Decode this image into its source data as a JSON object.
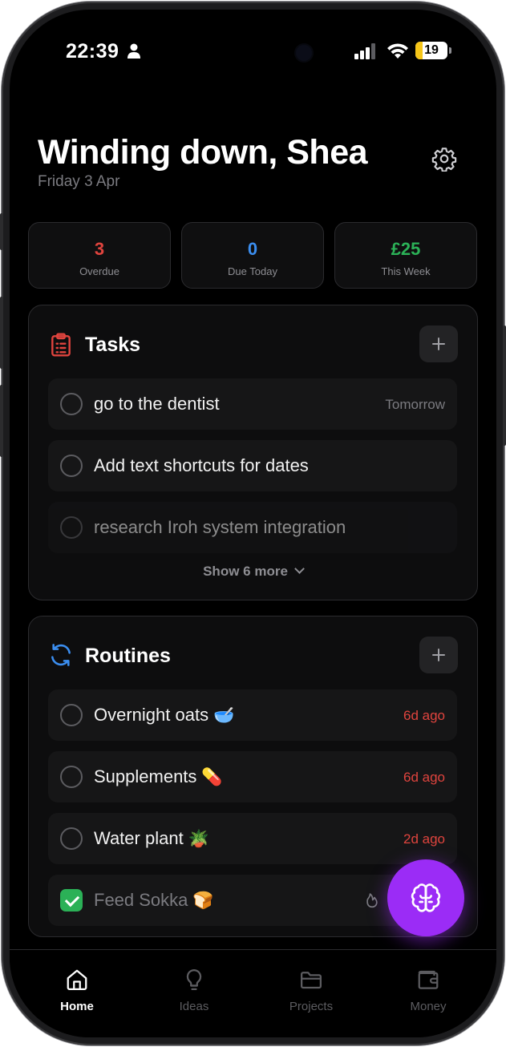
{
  "status_bar": {
    "time": "22:39",
    "battery": "19"
  },
  "header": {
    "greeting": "Winding down, Shea",
    "date": "Friday 3 Apr"
  },
  "stats": [
    {
      "value": "3",
      "label": "Overdue",
      "color": "#e0443e"
    },
    {
      "value": "0",
      "label": "Due Today",
      "color": "#3b8ef0"
    },
    {
      "value": "£25",
      "label": "This Week",
      "color": "#2bb157"
    }
  ],
  "tasks": {
    "title": "Tasks",
    "items": [
      {
        "label": "go to the dentist",
        "meta": "Tomorrow"
      },
      {
        "label": "Add text shortcuts for dates",
        "meta": ""
      },
      {
        "label": "research Iroh system integration",
        "meta": ""
      }
    ],
    "show_more": "Show 6 more"
  },
  "routines": {
    "title": "Routines",
    "items": [
      {
        "label": "Overnight oats",
        "emoji": "🥣",
        "meta": "6d ago"
      },
      {
        "label": "Supplements",
        "emoji": "💊",
        "meta": "6d ago"
      },
      {
        "label": "Water plant",
        "emoji": "🪴",
        "meta": "2d ago"
      },
      {
        "label": "Feed Sokka",
        "emoji": "🍞",
        "meta": ""
      }
    ]
  },
  "nav": {
    "items": [
      {
        "label": "Home",
        "icon": "home-icon"
      },
      {
        "label": "Ideas",
        "icon": "lightbulb-icon"
      },
      {
        "label": "Projects",
        "icon": "folder-icon"
      },
      {
        "label": "Money",
        "icon": "wallet-icon"
      }
    ]
  },
  "colors": {
    "accent": "#9b2cf6",
    "overdue": "#e0443e",
    "due_today": "#3b8ef0",
    "this_week": "#2bb157"
  }
}
